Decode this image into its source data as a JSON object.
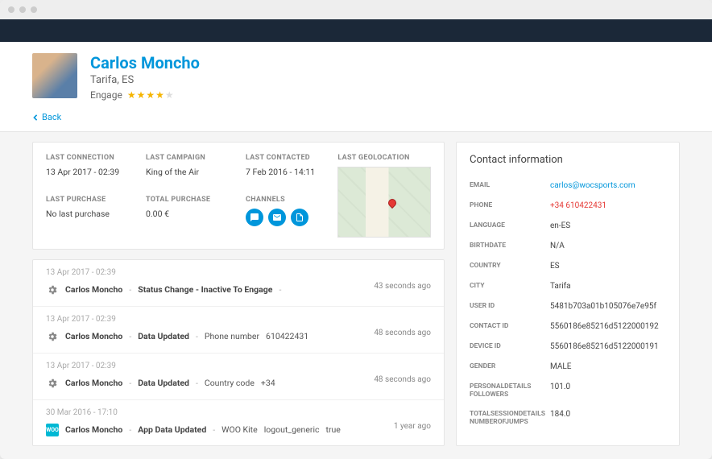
{
  "header": {
    "name": "Carlos Moncho",
    "location": "Tarifa, ES",
    "engage_label": "Engage",
    "stars_filled": 4,
    "stars_total": 5
  },
  "nav": {
    "back_label": "Back"
  },
  "summary": {
    "last_connection": {
      "label": "LAST CONNECTION",
      "value": "13 Apr 2017 - 02:39"
    },
    "last_campaign": {
      "label": "LAST CAMPAIGN",
      "value": "King of the Air"
    },
    "last_contacted": {
      "label": "LAST CONTACTED",
      "value": "7 Feb 2016 - 14:11"
    },
    "last_geolocation": {
      "label": "LAST GEOLOCATION"
    },
    "last_purchase": {
      "label": "LAST PURCHASE",
      "value": "No last purchase"
    },
    "total_purchase": {
      "label": "TOTAL PURCHASE",
      "value": "0.00 €"
    },
    "channels": {
      "label": "CHANNELS"
    }
  },
  "channels": [
    "chat-icon",
    "mail-icon",
    "note-icon"
  ],
  "timeline": [
    {
      "date": "13 Apr 2017 - 02:39",
      "icon": "gear-icon",
      "name": "Carlos Moncho",
      "event": "Status Change - Inactive To Engage",
      "field": "",
      "value": "",
      "ago": "43 seconds ago"
    },
    {
      "date": "13 Apr 2017 - 02:39",
      "icon": "gear-icon",
      "name": "Carlos Moncho",
      "event": "Data Updated",
      "field": "Phone number",
      "value": "610422431",
      "ago": "48 seconds ago"
    },
    {
      "date": "13 Apr 2017 - 02:39",
      "icon": "gear-icon",
      "name": "Carlos Moncho",
      "event": "Data Updated",
      "field": "Country code",
      "value": "+34",
      "ago": "48 seconds ago"
    },
    {
      "date": "30 Mar 2016 - 17:10",
      "icon": "app-icon",
      "name": "Carlos Moncho",
      "event": "App Data Updated",
      "field": "WOO Kite",
      "value": "logout_generic",
      "extra": "true",
      "ago": "1 year ago"
    }
  ],
  "contact": {
    "title": "Contact information",
    "rows": [
      {
        "label": "EMAIL",
        "value": "carlos@wocsports.com",
        "cls": "link"
      },
      {
        "label": "PHONE",
        "value": "+34 610422431",
        "cls": "red"
      },
      {
        "label": "LANGUAGE",
        "value": "en-ES"
      },
      {
        "label": "BIRTHDATE",
        "value": "N/A"
      },
      {
        "label": "COUNTRY",
        "value": "ES"
      },
      {
        "label": "CITY",
        "value": "Tarifa"
      },
      {
        "label": "USER ID",
        "value": "5481b703a01b105076e7e95f"
      },
      {
        "label": "CONTACT ID",
        "value": "5560186e85216d5122000192"
      },
      {
        "label": "DEVICE ID",
        "value": "5560186e85216d5122000191"
      },
      {
        "label": "GENDER",
        "value": "MALE"
      },
      {
        "label": "PERSONALDETAILS FOLLOWERS",
        "value": "101.0"
      },
      {
        "label": "TOTALSESSIONDETAILS NUMBEROFJUMPS",
        "value": "184.0"
      }
    ]
  }
}
